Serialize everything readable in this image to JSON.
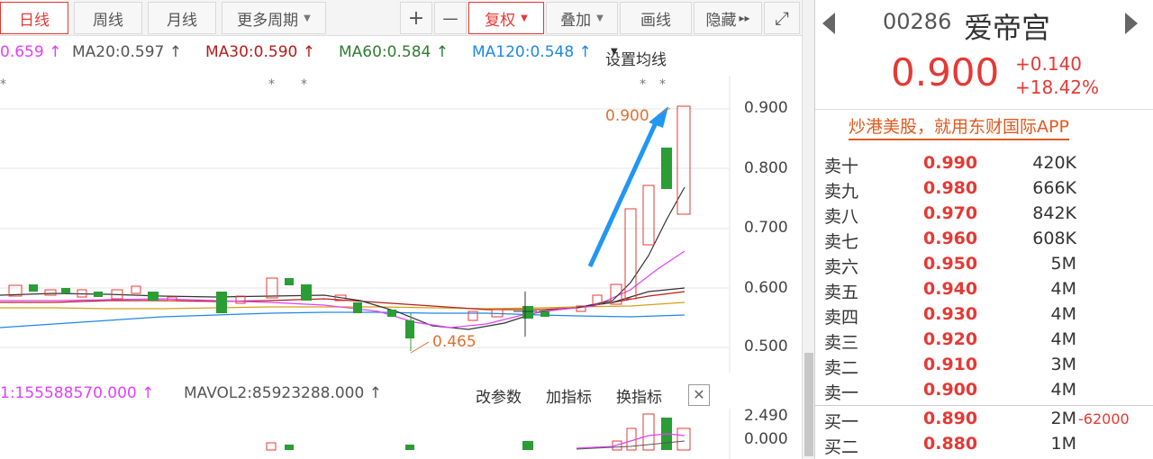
{
  "toolbar": {
    "periods": [
      "日线",
      "周线",
      "月线"
    ],
    "more_periods": "更多周期",
    "zoom_in": "+",
    "zoom_out": "一",
    "adjust": "复权",
    "overlay": "叠加",
    "draw": "画线",
    "hide": "隐藏",
    "hide_arrows": "▸▸",
    "fullscreen": "⤢"
  },
  "ma": {
    "ma10": "0.659 ↑",
    "ma20": "MA20:0.597 ↑",
    "ma30": "MA30:0.590 ↑",
    "ma60": "MA60:0.584 ↑",
    "ma120": "MA120:0.548 ↑",
    "settings": "设置均线"
  },
  "colors": {
    "up": "#e53935",
    "down": "#2a9d34",
    "ma10": "#e040fb",
    "ma20": "#555555",
    "ma30": "#b71c1c",
    "ma60": "#2e7d32",
    "ma120": "#1e88e5",
    "arrow": "#2196f3",
    "annot": "#e07030"
  },
  "chart": {
    "y_ticks": [
      "0.900",
      "0.800",
      "0.700",
      "0.600",
      "0.500"
    ],
    "high_label": "0.900",
    "low_label": "0.465",
    "markers": [
      "*",
      "*",
      "*",
      "*",
      "*"
    ]
  },
  "volume": {
    "mavol1": "1:155588570.000 ↑",
    "mavol2": "MAVOL2:85923288.000 ↑",
    "change_params": "改参数",
    "add_indicator": "加指标",
    "switch_indicator": "换指标",
    "close": "✕",
    "y_ticks": [
      "2.490",
      "0.000"
    ]
  },
  "stock": {
    "code": "00286",
    "name": "爱帝宫",
    "price": "0.900",
    "change": "+0.140",
    "change_pct": "+18.42%",
    "ad": "炒港美股，就用东财国际APP"
  },
  "orderbook": [
    {
      "label": "卖十",
      "price": "0.990",
      "vol": "420K",
      "extra": ""
    },
    {
      "label": "卖九",
      "price": "0.980",
      "vol": "666K",
      "extra": ""
    },
    {
      "label": "卖八",
      "price": "0.970",
      "vol": "842K",
      "extra": ""
    },
    {
      "label": "卖七",
      "price": "0.960",
      "vol": "608K",
      "extra": ""
    },
    {
      "label": "卖六",
      "price": "0.950",
      "vol": "5M",
      "extra": ""
    },
    {
      "label": "卖五",
      "price": "0.940",
      "vol": "4M",
      "extra": ""
    },
    {
      "label": "卖四",
      "price": "0.930",
      "vol": "4M",
      "extra": ""
    },
    {
      "label": "卖三",
      "price": "0.920",
      "vol": "4M",
      "extra": ""
    },
    {
      "label": "卖二",
      "price": "0.910",
      "vol": "3M",
      "extra": ""
    },
    {
      "label": "卖一",
      "price": "0.900",
      "vol": "4M",
      "extra": ""
    },
    {
      "label": "买一",
      "price": "0.890",
      "vol": "2M",
      "extra": "-62000"
    },
    {
      "label": "买二",
      "price": "0.880",
      "vol": "1M",
      "extra": ""
    }
  ]
}
